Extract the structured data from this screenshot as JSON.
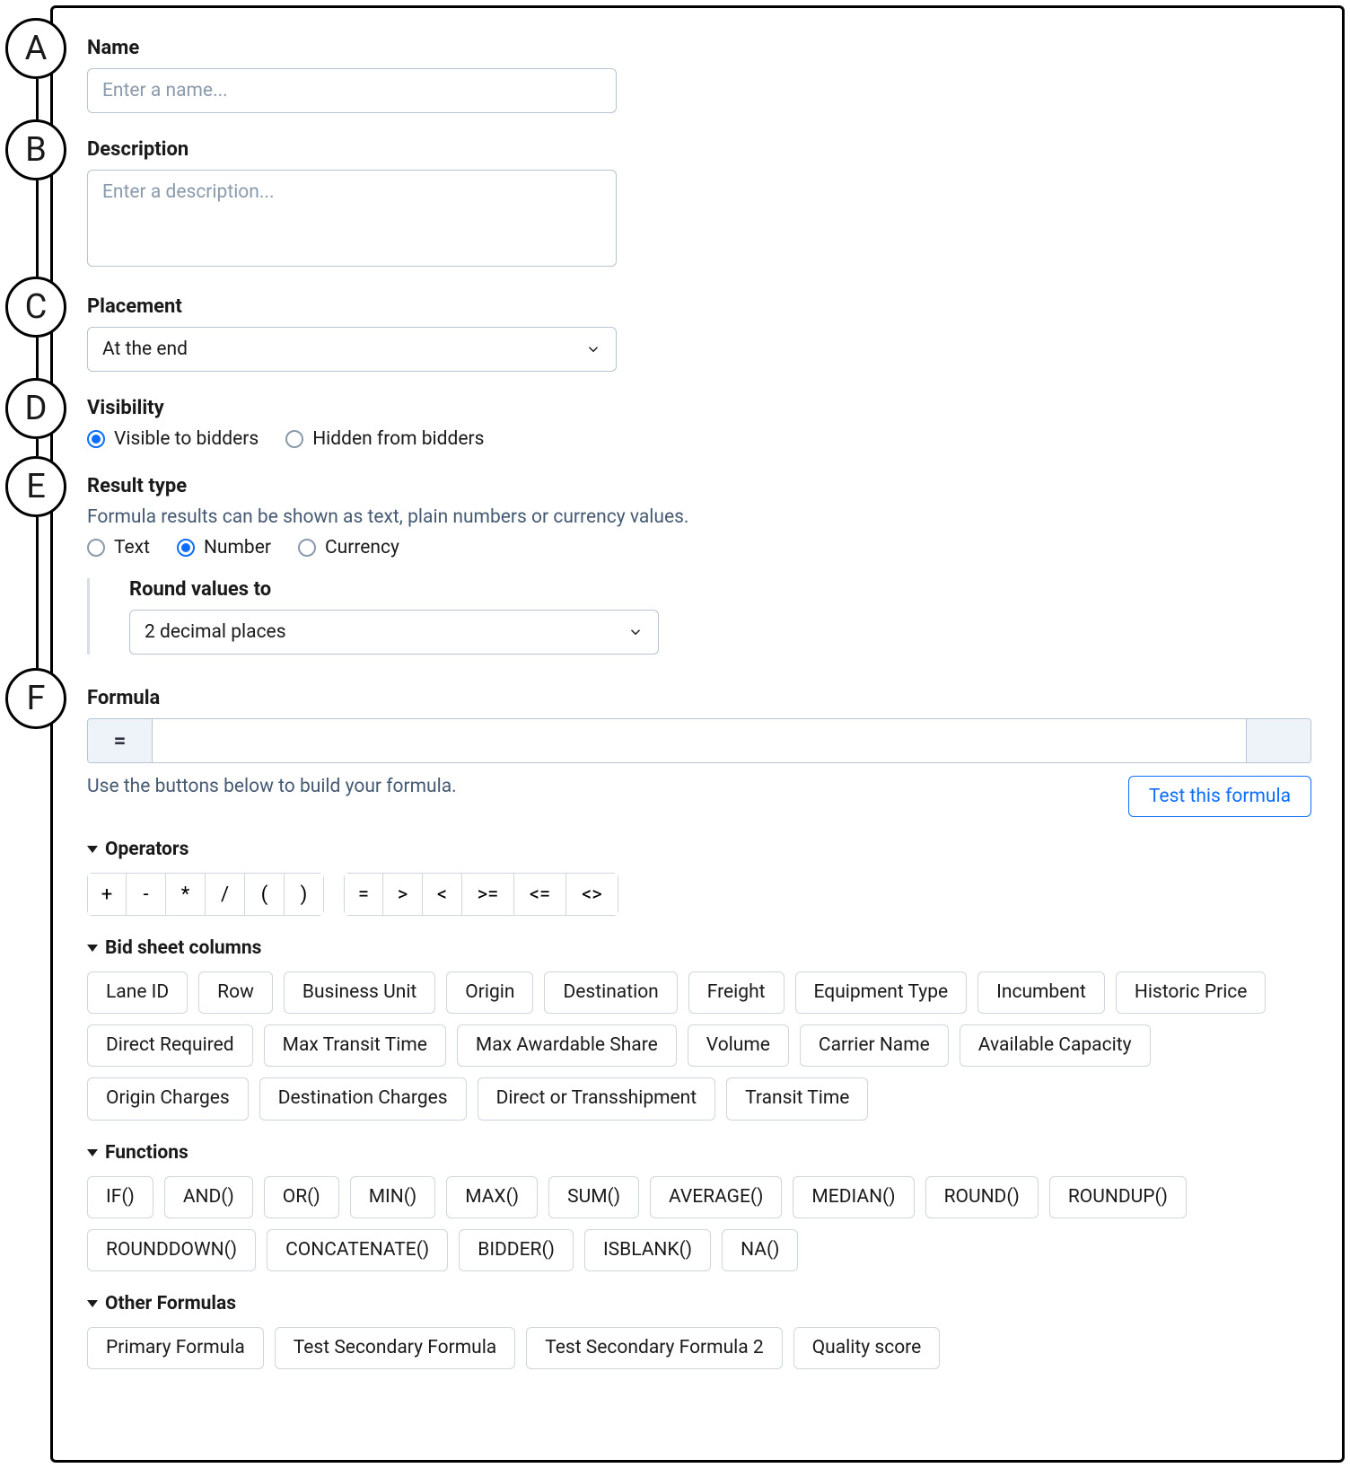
{
  "badges": [
    "A",
    "B",
    "C",
    "D",
    "E",
    "F"
  ],
  "name": {
    "label": "Name",
    "placeholder": "Enter a name...",
    "value": ""
  },
  "description": {
    "label": "Description",
    "placeholder": "Enter a description...",
    "value": ""
  },
  "placement": {
    "label": "Placement",
    "selected": "At the end"
  },
  "visibility": {
    "label": "Visibility",
    "options": [
      "Visible to bidders",
      "Hidden from bidders"
    ],
    "selected": "Visible to bidders"
  },
  "resultType": {
    "label": "Result type",
    "help": "Formula results can be shown as text, plain numbers or currency values.",
    "options": [
      "Text",
      "Number",
      "Currency"
    ],
    "selected": "Number",
    "round": {
      "label": "Round values to",
      "selected": "2 decimal places"
    }
  },
  "formula": {
    "label": "Formula",
    "prefix": "=",
    "value": "",
    "hint": "Use the buttons below to build your formula.",
    "testButton": "Test this formula"
  },
  "operators": {
    "heading": "Operators",
    "arith": [
      "+",
      "-",
      "*",
      "/",
      "(",
      ")"
    ],
    "compare": [
      "=",
      ">",
      "<",
      ">=",
      "<=",
      "<>"
    ]
  },
  "bidColumns": {
    "heading": "Bid sheet columns",
    "items": [
      "Lane ID",
      "Row",
      "Business Unit",
      "Origin",
      "Destination",
      "Freight",
      "Equipment Type",
      "Incumbent",
      "Historic Price",
      "Direct Required",
      "Max Transit Time",
      "Max Awardable Share",
      "Volume",
      "Carrier Name",
      "Available Capacity",
      "Origin Charges",
      "Destination Charges",
      "Direct or Transshipment",
      "Transit Time"
    ]
  },
  "functions": {
    "heading": "Functions",
    "items": [
      "IF()",
      "AND()",
      "OR()",
      "MIN()",
      "MAX()",
      "SUM()",
      "AVERAGE()",
      "MEDIAN()",
      "ROUND()",
      "ROUNDUP()",
      "ROUNDDOWN()",
      "CONCATENATE()",
      "BIDDER()",
      "ISBLANK()",
      "NA()"
    ]
  },
  "otherFormulas": {
    "heading": "Other Formulas",
    "items": [
      "Primary Formula",
      "Test Secondary Formula",
      "Test Secondary Formula 2",
      "Quality score"
    ]
  }
}
